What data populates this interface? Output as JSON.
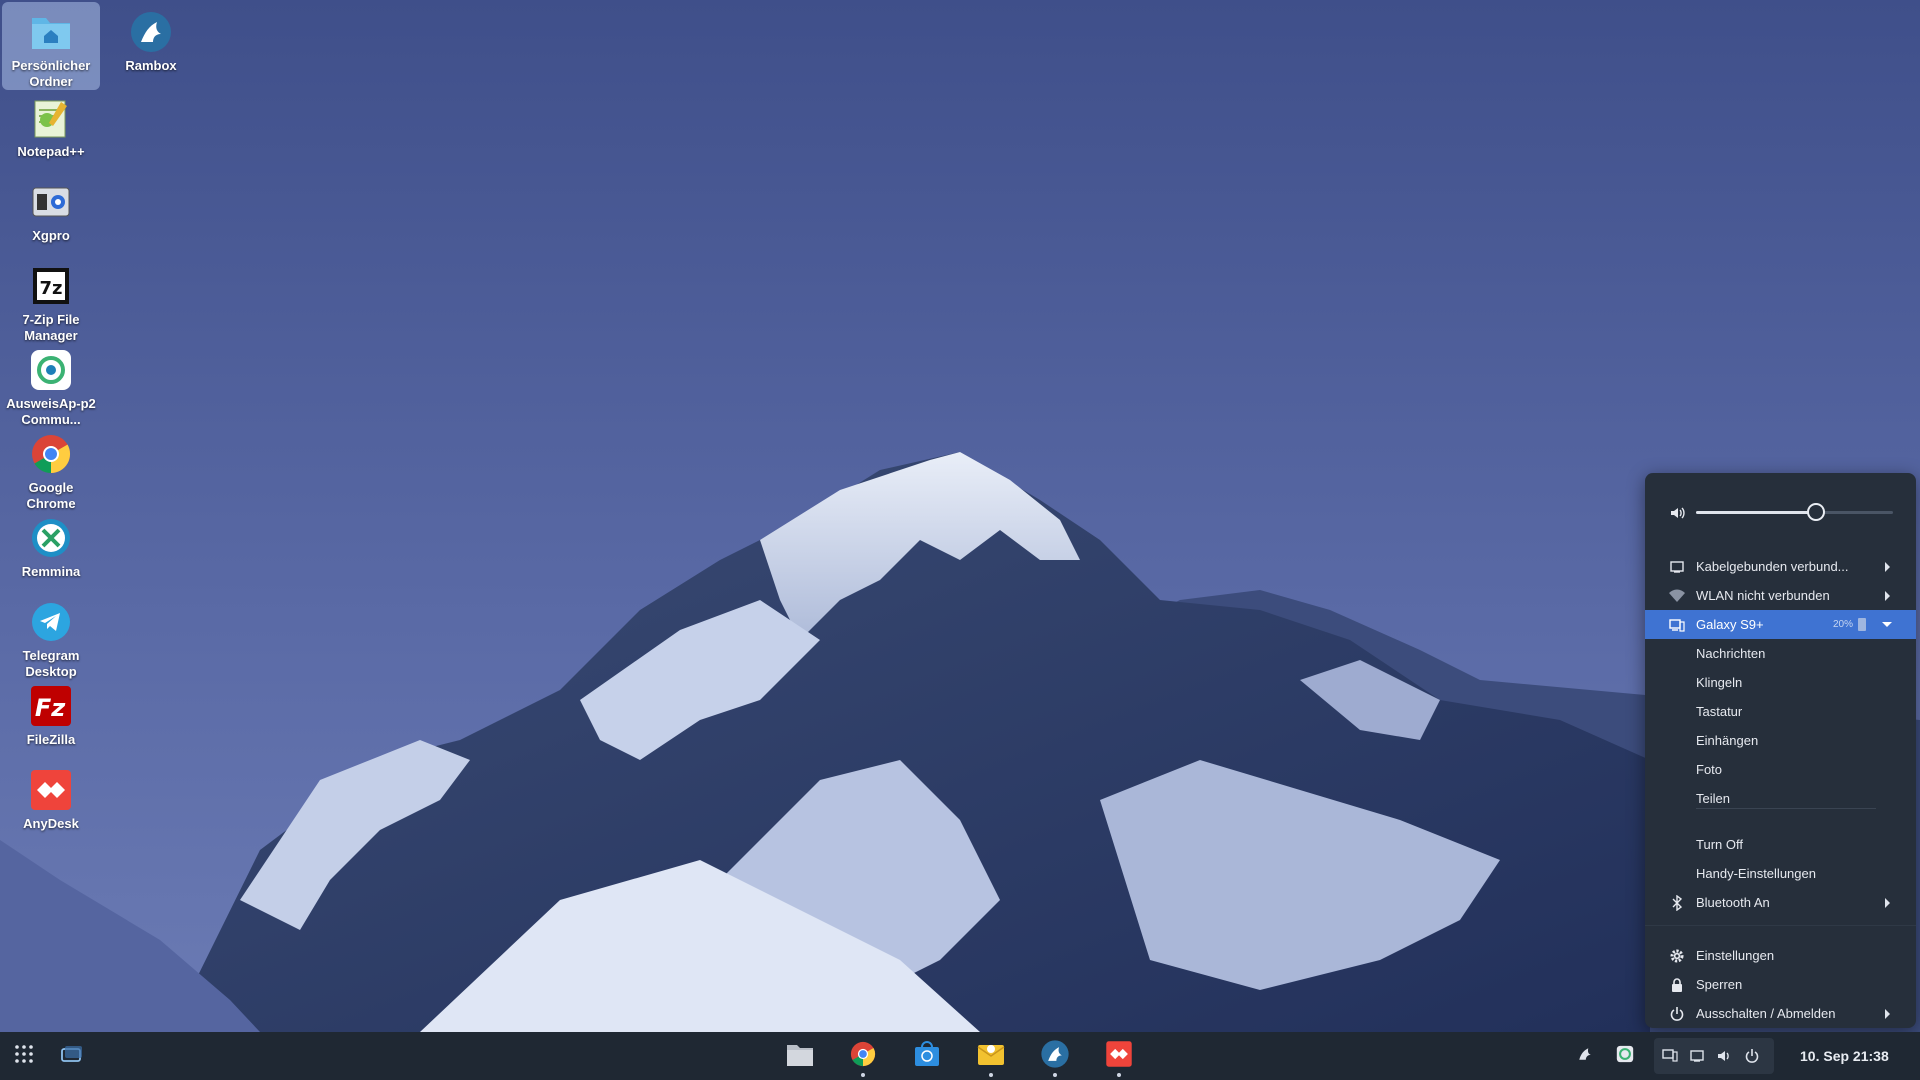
{
  "desktop_icons": [
    {
      "label": "Persönlicher Ordner",
      "icon": "home-folder-icon",
      "selected": true
    },
    {
      "label": "Rambox",
      "icon": "rambox-icon"
    },
    {
      "label": "Notepad++",
      "icon": "notepadpp-icon"
    },
    {
      "label": "Xgpro",
      "icon": "xgpro-icon"
    },
    {
      "label": "7-Zip File Manager",
      "icon": "7zip-icon"
    },
    {
      "label": "AusweisAp-p2 Commu...",
      "icon": "ausweisapp-icon"
    },
    {
      "label": "Google Chrome",
      "icon": "chrome-icon"
    },
    {
      "label": "Remmina",
      "icon": "remmina-icon"
    },
    {
      "label": "Telegram Desktop",
      "icon": "telegram-icon"
    },
    {
      "label": "FileZilla",
      "icon": "filezilla-icon"
    },
    {
      "label": "AnyDesk",
      "icon": "anydesk-icon"
    }
  ],
  "taskbar": {
    "apps": [
      "files-icon",
      "chrome-icon",
      "software-store-icon",
      "mail-icon",
      "rambox-icon",
      "anydesk-icon"
    ],
    "clock": "10. Sep  21:38"
  },
  "menu": {
    "volume_level": 0.6,
    "items": {
      "wired": "Kabelgebunden verbund...",
      "wifi": "WLAN nicht verbunden",
      "device": "Galaxy S9+",
      "battery": "20%",
      "sub": [
        "Nachrichten",
        "Klingeln",
        "Tastatur",
        "Einhängen",
        "Foto",
        "Teilen"
      ],
      "turn_off": "Turn Off",
      "phone_settings": "Handy-Einstellungen",
      "bluetooth": "Bluetooth An",
      "settings": "Einstellungen",
      "lock": "Sperren",
      "power": "Ausschalten / Abmelden"
    }
  },
  "colors": {
    "accent": "#3f73d2",
    "panel": "#262f3b",
    "taskbar": "#1f2833"
  }
}
